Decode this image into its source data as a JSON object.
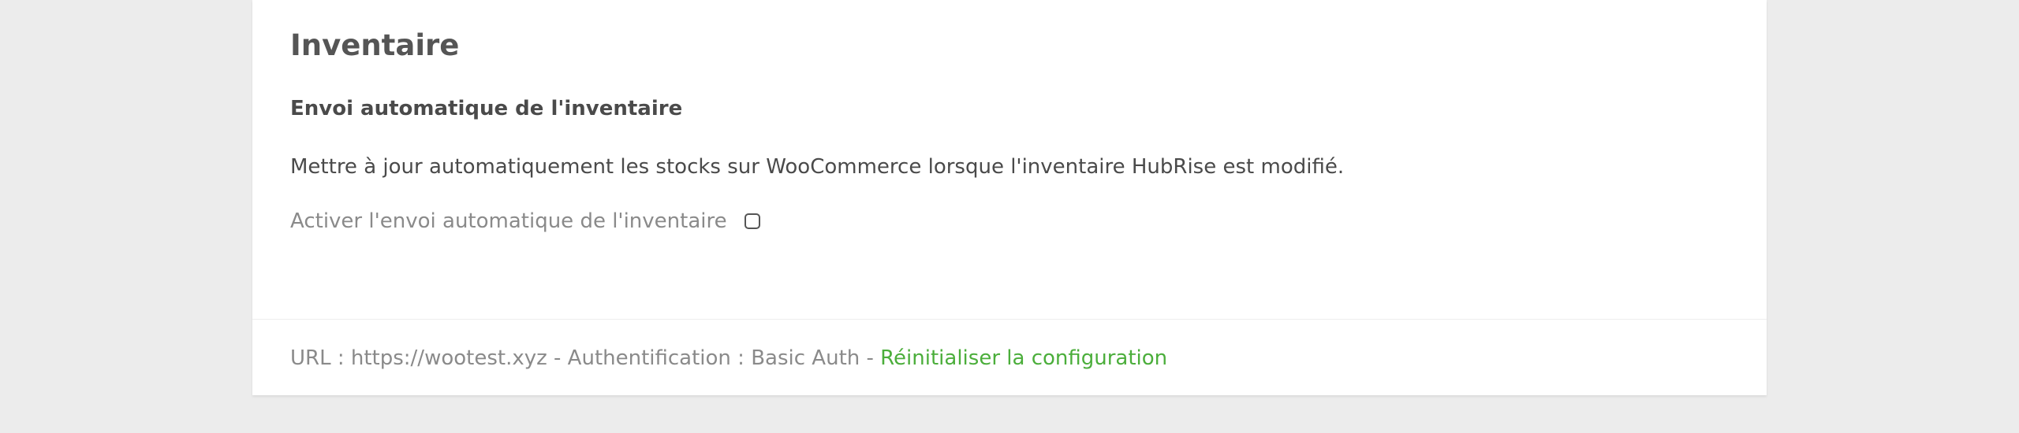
{
  "inventory": {
    "title": "Inventaire",
    "subtitle": "Envoi automatique de l'inventaire",
    "description": "Mettre à jour automatiquement les stocks sur WooCommerce lorsque l'inventaire HubRise est modifié.",
    "auto_send_label": "Activer l'envoi automatique de l'inventaire",
    "auto_send_checked": false
  },
  "footer": {
    "info_text": "URL : https://wootest.xyz - Authentification : Basic Auth - ",
    "reset_link_label": "Réinitialiser la configuration"
  },
  "colors": {
    "background": "#ececec",
    "card": "#ffffff",
    "link": "#4bae3b",
    "muted_text": "#8a8a8a"
  }
}
